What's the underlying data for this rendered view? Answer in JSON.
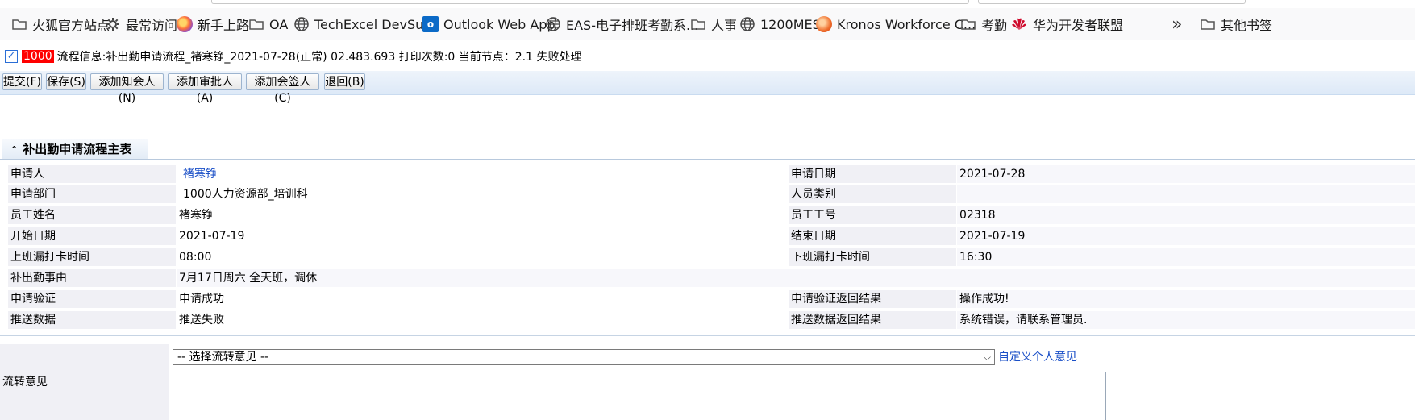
{
  "bookmarks": [
    {
      "label": "火狐官方站点",
      "icon": "folder-icon"
    },
    {
      "label": "最常访问",
      "icon": "gear-icon"
    },
    {
      "label": "新手上路",
      "icon": "firefox-icon"
    },
    {
      "label": "OA",
      "icon": "folder-icon"
    },
    {
      "label": "TechExcel DevSuite",
      "icon": "globe-icon"
    },
    {
      "label": "Outlook Web App",
      "icon": "outlook-icon"
    },
    {
      "label": "EAS-电子排班考勤系...",
      "icon": "globe-icon"
    },
    {
      "label": "人事",
      "icon": "folder-icon"
    },
    {
      "label": "1200MES",
      "icon": "globe-icon"
    },
    {
      "label": "Kronos Workforce C...",
      "icon": "kronos-icon"
    },
    {
      "label": "考勤",
      "icon": "folder-icon"
    },
    {
      "label": "华为开发者联盟",
      "icon": "huawei-icon"
    },
    {
      "label": "其他书签",
      "icon": "folder-icon"
    }
  ],
  "flow": {
    "badge": "1000",
    "text": "流程信息:补出勤申请流程_褚寒铮_2021-07-28(正常) 02.483.693 打印次数:0 当前节点：2.1 失败处理"
  },
  "toolbar": {
    "submit": "提交(F)",
    "save": "保存(S)",
    "add_notifier": "添加知会人(N)",
    "add_approver": "添加审批人(A)",
    "add_cosigner": "添加会签人(C)",
    "return": "退回(B)"
  },
  "section": {
    "title": "补出勤申请流程主表"
  },
  "form": {
    "applicant_label": "申请人",
    "applicant": "褚寒铮",
    "apply_date_label": "申请日期",
    "apply_date": "2021-07-28",
    "dept_label": "申请部门",
    "dept": "1000人力资源部_培训科",
    "staff_type_label": "人员类别",
    "staff_type": "",
    "emp_name_label": "员工姓名",
    "emp_name": "褚寒铮",
    "emp_no_label": "员工工号",
    "emp_no": "02318",
    "start_label": "开始日期",
    "start": "2021-07-19",
    "end_label": "结束日期",
    "end": "2021-07-19",
    "in_time_label": "上班漏打卡时间",
    "in_time": "08:00",
    "out_time_label": "下班漏打卡时间",
    "out_time": "16:30",
    "reason_label": "补出勤事由",
    "reason": "7月17日周六   全天班，调休",
    "verify_label": "申请验证",
    "verify": "申请成功",
    "verify_result_label": "申请验证返回结果",
    "verify_result": "操作成功!",
    "push_label": "推送数据",
    "push": "推送失败",
    "push_result_label": "推送数据返回结果",
    "push_result": "系统错误，请联系管理员."
  },
  "comment": {
    "label": "流转意见",
    "select_value": "-- 选择流转意见 --",
    "custom_link": "自定义个人意见"
  }
}
